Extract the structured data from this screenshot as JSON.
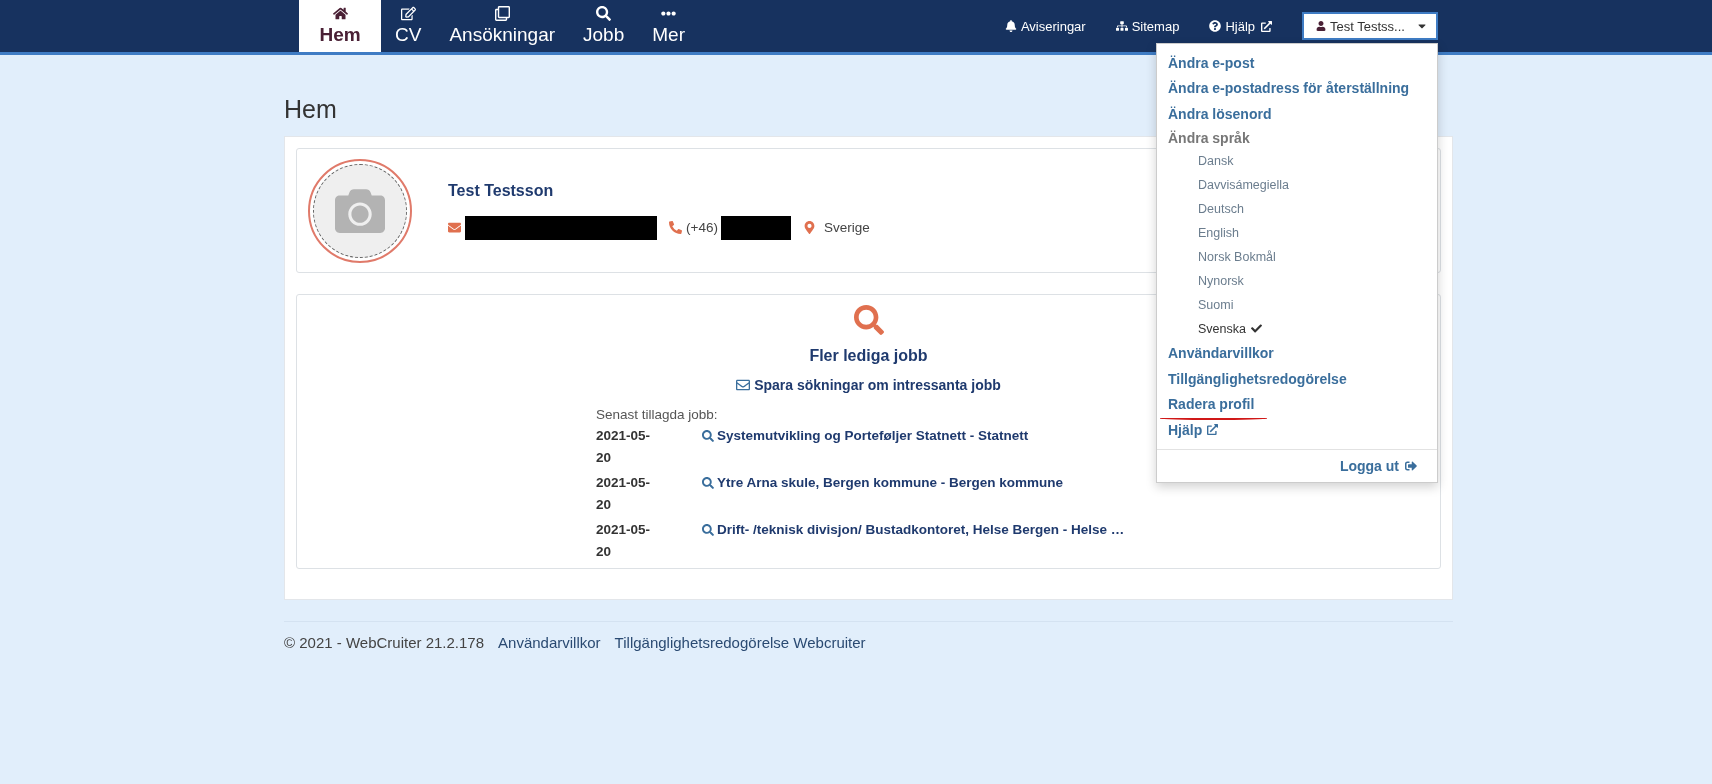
{
  "nav": {
    "tabs": [
      {
        "label": "Hem",
        "selected": true
      },
      {
        "label": "CV",
        "selected": false
      },
      {
        "label": "Ansökningar",
        "selected": false
      },
      {
        "label": "Jobb",
        "selected": false
      },
      {
        "label": "Mer",
        "selected": false
      }
    ],
    "links": [
      {
        "label": "Aviseringar",
        "external": false
      },
      {
        "label": "Sitemap",
        "external": false
      },
      {
        "label": "Hjälp",
        "external": true
      }
    ],
    "user_button": {
      "label": "Test Testss...",
      "expanded": true
    }
  },
  "user_menu": {
    "items": [
      {
        "kind": "link",
        "label": "Ändra e-post"
      },
      {
        "kind": "link",
        "label": "Ändra e-postadress för återställning"
      },
      {
        "kind": "link",
        "label": "Ändra lösenord"
      },
      {
        "kind": "heading",
        "label": "Ändra språk"
      },
      {
        "kind": "language",
        "label": "Dansk",
        "selected": false
      },
      {
        "kind": "language",
        "label": "Davvisámegiella",
        "selected": false
      },
      {
        "kind": "language",
        "label": "Deutsch",
        "selected": false
      },
      {
        "kind": "language",
        "label": "English",
        "selected": false
      },
      {
        "kind": "language",
        "label": "Norsk Bokmål",
        "selected": false
      },
      {
        "kind": "language",
        "label": "Nynorsk",
        "selected": false
      },
      {
        "kind": "language",
        "label": "Suomi",
        "selected": false
      },
      {
        "kind": "language",
        "label": "Svenska",
        "selected": true
      },
      {
        "kind": "link",
        "label": "Användarvillkor"
      },
      {
        "kind": "link",
        "label": "Tillgänglighetsredogörelse"
      },
      {
        "kind": "link",
        "label": "Radera profil",
        "annotated": true
      },
      {
        "kind": "external",
        "label": "Hjälp"
      }
    ],
    "logout": "Logga ut"
  },
  "page_title": "Hem",
  "profile": {
    "name": "Test Testsson",
    "phone_prefix": "(+46)",
    "location": "Sverige"
  },
  "jobs": {
    "title": "Fler lediga jobb",
    "save_link": "Spara sökningar om intressanta jobb",
    "recent_label": "Senast tillagda jobb:",
    "rows": [
      {
        "date": "2021-05-20",
        "title": "Systemutvikling og Porteføljer Statnett - Statnett"
      },
      {
        "date": "2021-05-20",
        "title": "Ytre Arna skule, Bergen kommune - Bergen kommune"
      },
      {
        "date": "2021-05-20",
        "title": "Drift- /teknisk divisjon/ Bustadkontoret, Helse Bergen - Helse …"
      }
    ]
  },
  "footer": {
    "copyright": "© 2021 - WebCruiter 21.2.178",
    "links": [
      "Användarvillkor",
      "Tillgänglighetsredogörelse Webcruiter"
    ]
  }
}
